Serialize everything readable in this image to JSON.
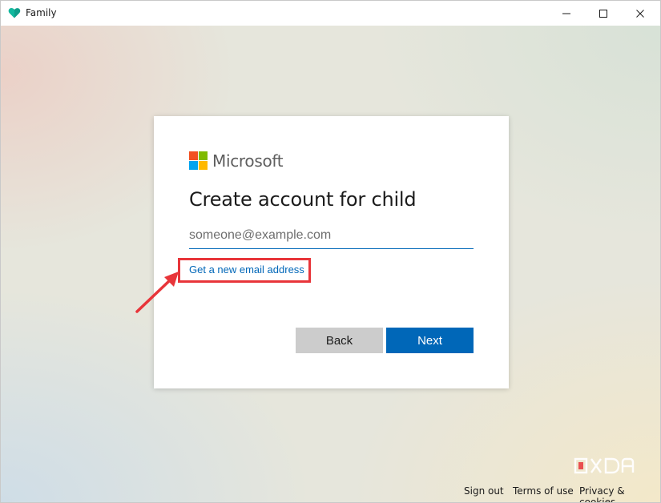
{
  "window": {
    "title": "Family",
    "controls": [
      "minimize",
      "maximize",
      "close"
    ]
  },
  "card": {
    "brand": "Microsoft",
    "heading": "Create account for child",
    "email_placeholder": "someone@example.com",
    "email_value": "",
    "new_email_link": "Get a new email address",
    "back_label": "Back",
    "next_label": "Next"
  },
  "footer": {
    "sign_out": "Sign out",
    "terms": "Terms of use",
    "privacy": "Privacy & cookies"
  },
  "watermark": "XDA",
  "colors": {
    "accent": "#0067b8",
    "highlight": "#e8353a",
    "ms_red": "#f25022",
    "ms_green": "#7fba00",
    "ms_blue": "#00a4ef",
    "ms_yellow": "#ffb900"
  },
  "icons": {
    "app": "family-heart-icon",
    "minimize": "minimize-icon",
    "maximize": "maximize-icon",
    "close": "close-icon",
    "annotation": "red-arrow-icon"
  }
}
